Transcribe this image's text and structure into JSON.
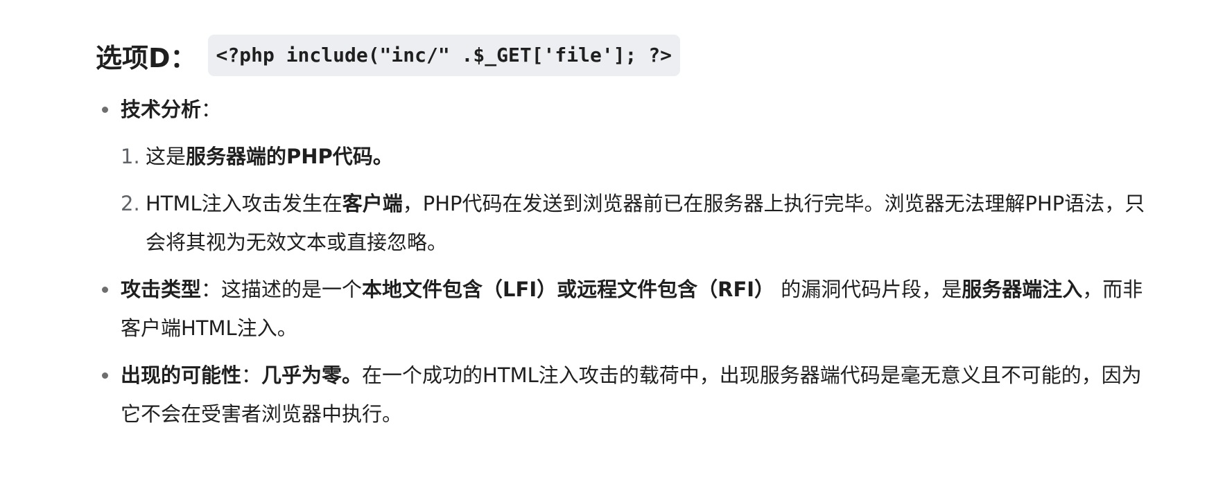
{
  "heading": {
    "label": "选项D：",
    "code": "<?php include(\"inc/\" .$_GET['file']; ?>"
  },
  "bullets": [
    {
      "label": "技术分析",
      "colon": "：",
      "items": [
        {
          "number": "1.",
          "prefix": "这是",
          "bold": "服务器端的PHP代码。"
        },
        {
          "number": "2.",
          "prefix": "HTML注入攻击发生在",
          "bold": "客户端",
          "suffix": "，PHP代码在发送到浏览器前已在服务器上执行完毕。浏览器无法理解PHP语法，只会将其视为无效文本或直接忽略。"
        }
      ]
    },
    {
      "label": "攻击类型",
      "colon": "：",
      "text1": "这描述的是一个",
      "bold1": "本地文件包含（LFI）或远程文件包含（RFI）",
      "text2": " 的漏洞代码片段，是",
      "bold2": "服务器端注入",
      "text3": "，而非客户端HTML注入。"
    },
    {
      "label": "出现的可能性",
      "colon": "：",
      "bold1": "几乎为零。",
      "text1": "在一个成功的HTML注入攻击的载荷中，出现服务器端代码是毫无意义且不可能的，因为它不会在受害者浏览器中执行。"
    }
  ]
}
